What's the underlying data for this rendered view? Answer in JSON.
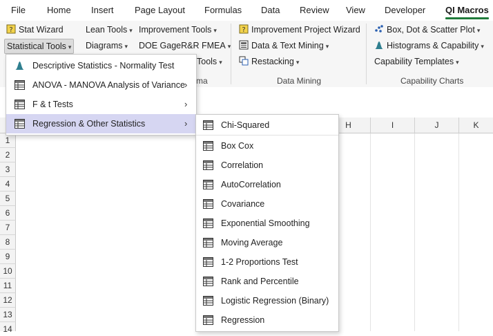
{
  "tabs": [
    "File",
    "Home",
    "Insert",
    "Page Layout",
    "Formulas",
    "Data",
    "Review",
    "View",
    "Developer",
    "QI Macros"
  ],
  "active_tab": "QI Macros",
  "ribbon": {
    "stat_wizard": "Stat Wizard",
    "statistical_tools": "Statistical Tools",
    "lean_tools": "Lean Tools",
    "diagrams": "Diagrams",
    "improvement_tools": "Improvement Tools",
    "doe_gage": "DOE GageR&R FMEA",
    "tools_partial": "Tools",
    "improvement_project_wizard": "Improvement Project Wizard",
    "data_text_mining": "Data & Text Mining",
    "restacking": "Restacking",
    "box_dot_scatter": "Box, Dot & Scatter Plot",
    "histograms_capability": "Histograms & Capability",
    "capability_templates": "Capability Templates",
    "group_partial": "ma",
    "group_data_mining": "Data Mining",
    "group_capability_charts": "Capability Charts"
  },
  "menu": {
    "items": [
      {
        "label": "Descriptive Statistics - Normality Test",
        "icon": "bell-curve-icon",
        "submenu": false
      },
      {
        "label": "ANOVA - MANOVA Analysis of Variance",
        "icon": "table-icon",
        "submenu": true
      },
      {
        "label": "F & t Tests",
        "icon": "table-icon",
        "submenu": true
      },
      {
        "label": "Regression & Other Statistics",
        "icon": "table-icon",
        "submenu": true
      }
    ]
  },
  "submenu": {
    "items": [
      "Chi-Squared",
      "Box Cox",
      "Correlation",
      "AutoCorrelation",
      "Covariance",
      "Exponential Smoothing",
      "Moving Average",
      "1-2 Proportions Test",
      "Rank and Percentile",
      "Logistic Regression (Binary)",
      "Regression"
    ]
  },
  "sheet": {
    "columns": [
      "H",
      "I",
      "J",
      "K"
    ],
    "rows": [
      "1",
      "2",
      "3",
      "4",
      "5",
      "6",
      "7",
      "8",
      "9",
      "10",
      "11",
      "12",
      "13",
      "14"
    ]
  },
  "colors": {
    "accent": "#1f7a3a",
    "selected_item": "#d6d6f2",
    "hover_item": "#e6e6e6"
  }
}
